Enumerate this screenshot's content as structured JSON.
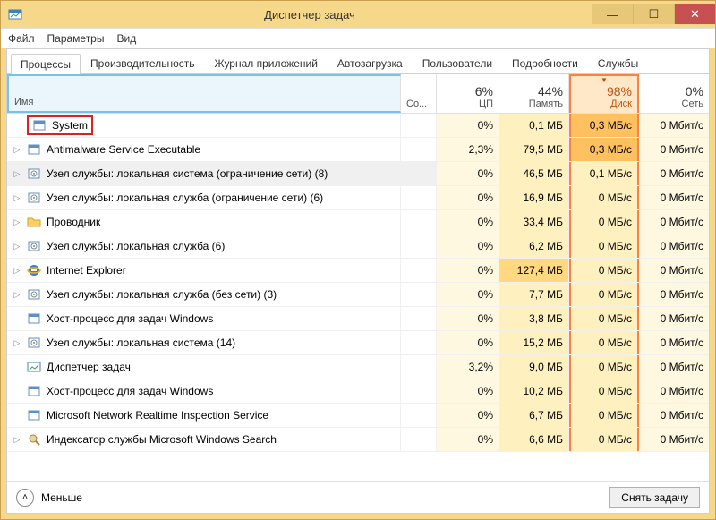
{
  "window": {
    "title": "Диспетчер задач"
  },
  "menu": {
    "file": "Файл",
    "options": "Параметры",
    "view": "Вид"
  },
  "tabs": [
    {
      "label": "Процессы",
      "active": true
    },
    {
      "label": "Производительность",
      "active": false
    },
    {
      "label": "Журнал приложений",
      "active": false
    },
    {
      "label": "Автозагрузка",
      "active": false
    },
    {
      "label": "Пользователи",
      "active": false
    },
    {
      "label": "Подробности",
      "active": false
    },
    {
      "label": "Службы",
      "active": false
    }
  ],
  "columns": {
    "name": "Имя",
    "status": "Со...",
    "cpu": {
      "pct": "6%",
      "label": "ЦП"
    },
    "memory": {
      "pct": "44%",
      "label": "Память"
    },
    "disk": {
      "pct": "98%",
      "label": "Диск"
    },
    "network": {
      "pct": "0%",
      "label": "Сеть"
    }
  },
  "processes": [
    {
      "icon": "window-icon",
      "expandable": false,
      "name": "System",
      "cpu": "0%",
      "mem": "0,1 МБ",
      "disk": "0,3 МБ/с",
      "net": "0 Мбит/с",
      "highlight_name": true,
      "disk_hot": true
    },
    {
      "icon": "window-icon",
      "expandable": true,
      "name": "Antimalware Service Executable",
      "cpu": "2,3%",
      "mem": "79,5 МБ",
      "disk": "0,3 МБ/с",
      "net": "0 Мбит/с",
      "disk_hot": true
    },
    {
      "icon": "gear-icon",
      "expandable": true,
      "name": "Узел службы: локальная система (ограничение сети) (8)",
      "cpu": "0%",
      "mem": "46,5 МБ",
      "disk": "0,1 МБ/с",
      "net": "0 Мбит/с",
      "selected": true
    },
    {
      "icon": "gear-icon",
      "expandable": true,
      "name": "Узел службы: локальная служба (ограничение сети) (6)",
      "cpu": "0%",
      "mem": "16,9 МБ",
      "disk": "0 МБ/с",
      "net": "0 Мбит/с"
    },
    {
      "icon": "folder-icon",
      "expandable": true,
      "name": "Проводник",
      "cpu": "0%",
      "mem": "33,4 МБ",
      "disk": "0 МБ/с",
      "net": "0 Мбит/с"
    },
    {
      "icon": "gear-icon",
      "expandable": true,
      "name": "Узел службы: локальная служба (6)",
      "cpu": "0%",
      "mem": "6,2 МБ",
      "disk": "0 МБ/с",
      "net": "0 Мбит/с"
    },
    {
      "icon": "ie-icon",
      "expandable": true,
      "name": "Internet Explorer",
      "cpu": "0%",
      "mem": "127,4 МБ",
      "disk": "0 МБ/с",
      "net": "0 Мбит/с",
      "mem_hot": true
    },
    {
      "icon": "gear-icon",
      "expandable": true,
      "name": "Узел службы: локальная служба (без сети) (3)",
      "cpu": "0%",
      "mem": "7,7 МБ",
      "disk": "0 МБ/с",
      "net": "0 Мбит/с"
    },
    {
      "icon": "window-icon",
      "expandable": false,
      "name": "Хост-процесс для задач Windows",
      "cpu": "0%",
      "mem": "3,8 МБ",
      "disk": "0 МБ/с",
      "net": "0 Мбит/с"
    },
    {
      "icon": "gear-icon",
      "expandable": true,
      "name": "Узел службы: локальная система (14)",
      "cpu": "0%",
      "mem": "15,2 МБ",
      "disk": "0 МБ/с",
      "net": "0 Мбит/с"
    },
    {
      "icon": "taskmgr-icon",
      "expandable": false,
      "name": "Диспетчер задач",
      "cpu": "3,2%",
      "mem": "9,0 МБ",
      "disk": "0 МБ/с",
      "net": "0 Мбит/с"
    },
    {
      "icon": "window-icon",
      "expandable": false,
      "name": "Хост-процесс для задач Windows",
      "cpu": "0%",
      "mem": "10,2 МБ",
      "disk": "0 МБ/с",
      "net": "0 Мбит/с"
    },
    {
      "icon": "window-icon",
      "expandable": false,
      "name": "Microsoft Network Realtime Inspection Service",
      "cpu": "0%",
      "mem": "6,7 МБ",
      "disk": "0 МБ/с",
      "net": "0 Мбит/с"
    },
    {
      "icon": "search-icon",
      "expandable": true,
      "name": "Индексатор службы Microsoft Windows Search",
      "cpu": "0%",
      "mem": "6,6 МБ",
      "disk": "0 МБ/с",
      "net": "0 Мбит/с"
    }
  ],
  "footer": {
    "fewer": "Меньше",
    "end_task": "Снять задачу"
  }
}
